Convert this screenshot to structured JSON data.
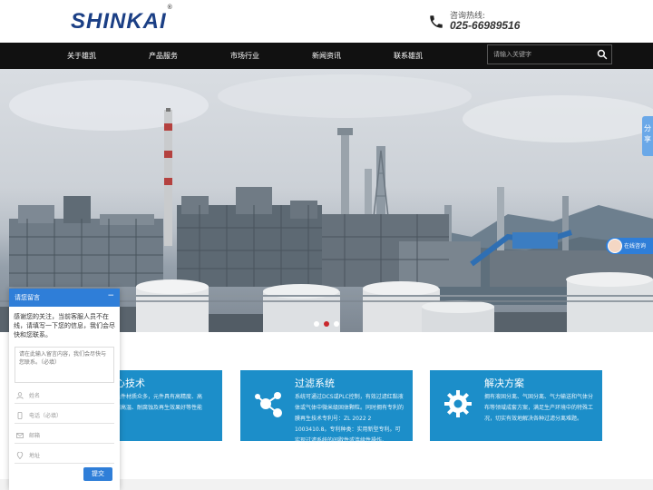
{
  "header": {
    "logo_text": "SHINKAI",
    "logo_mark": "®",
    "hotline_label": "咨询热线:",
    "hotline_number": "025-66989516"
  },
  "nav": {
    "items": [
      {
        "label": "关于雄凯"
      },
      {
        "label": "产品服务"
      },
      {
        "label": "市场行业"
      },
      {
        "label": "新闻资讯"
      },
      {
        "label": "联系雄凯"
      }
    ],
    "search_placeholder": "请输入关键字"
  },
  "banner": {
    "slide_count": 3,
    "active_slide": 2
  },
  "side_widgets": {
    "share_label": "分享",
    "online_chat_label": "在线咨询"
  },
  "features": [
    {
      "title": "核心技术",
      "visible_title": "心技术",
      "desc": "…元件材质众多，元件具有高精度、高…耐高温、耐腐蚀及再生效果好等性能",
      "desc_lines": [
        "元件材质众多，元件具有高精度、高",
        "耐高温、耐腐蚀及再生效果好等性能"
      ],
      "icon": "core-tech-icon"
    },
    {
      "title": "过滤系统",
      "desc": "系统可通过DCS或PLC控制，有效过滤红黏液体或气体中微米级固体颗粒。同时拥有专利的膜再生技术专利号：ZL 2022 2 1003410.8。专利种类：实用新型专利。可实现过滤系统的间歇性或连续性操作。",
      "icon": "molecule-icon"
    },
    {
      "title": "解决方案",
      "desc": "拥有液固分离、气固分离、气力输送和气体分布等领域成套方案，满足生产环境中的特殊工况，切实有效地解决各种过滤分离难题。",
      "icon": "gear-icon"
    }
  ],
  "message_panel": {
    "title": "请您留言",
    "minimize": "−",
    "intro": "感谢您的关注，当前客服人员不在线，请填写一下您的信息，我们会尽快和您联系。",
    "textarea_placeholder": "请在此输入留言内容，我们会尽快与您联系。（必填）",
    "fields": [
      {
        "placeholder": "姓名",
        "icon": "user-icon"
      },
      {
        "placeholder": "电话（必填）",
        "icon": "phone-icon"
      },
      {
        "placeholder": "邮箱",
        "icon": "mail-icon"
      },
      {
        "placeholder": "地址",
        "icon": "location-icon"
      }
    ],
    "submit_label": "提交"
  },
  "colors": {
    "brand_blue": "#1b3f85",
    "nav_bg": "#111111",
    "card_blue": "#1c8ec9",
    "chat_blue": "#2f7ed8",
    "active_dot": "#c9282d"
  }
}
